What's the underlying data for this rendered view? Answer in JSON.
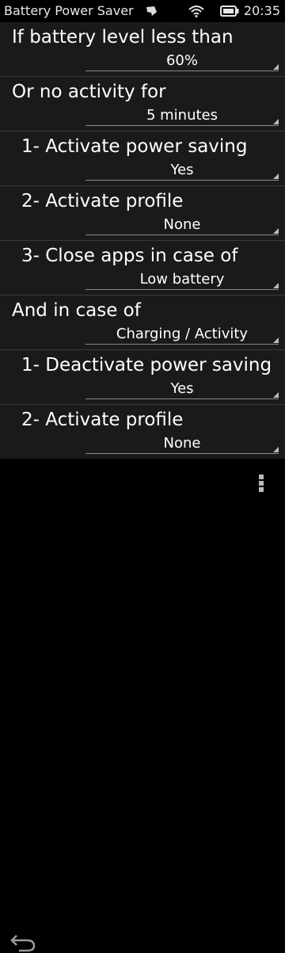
{
  "status_bar": {
    "app_title": "Battery Power Saver",
    "time": "20:35",
    "icons": [
      "notification-icon",
      "wifi-signal-icon",
      "battery-icon"
    ]
  },
  "settings": [
    {
      "label": "If battery level less than",
      "value": "60%"
    },
    {
      "label": "Or no activity for",
      "value": "5 minutes"
    },
    {
      "label": "1- Activate power saving",
      "value": "Yes"
    },
    {
      "label": "2- Activate profile",
      "value": "None"
    },
    {
      "label": "3- Close apps in case of",
      "value": "Low battery"
    },
    {
      "label": "And in case of",
      "value": "Charging / Activity"
    },
    {
      "label": "1- Deactivate power saving",
      "value": "Yes"
    },
    {
      "label": "2- Activate profile",
      "value": "None"
    }
  ],
  "toolbar": {
    "icons": [
      "back-icon",
      "menu-icon"
    ]
  },
  "colors": {
    "background": "#000000",
    "list_background": "#1a1a1a",
    "separator": "#3a3a3a",
    "text": "#ffffff"
  }
}
